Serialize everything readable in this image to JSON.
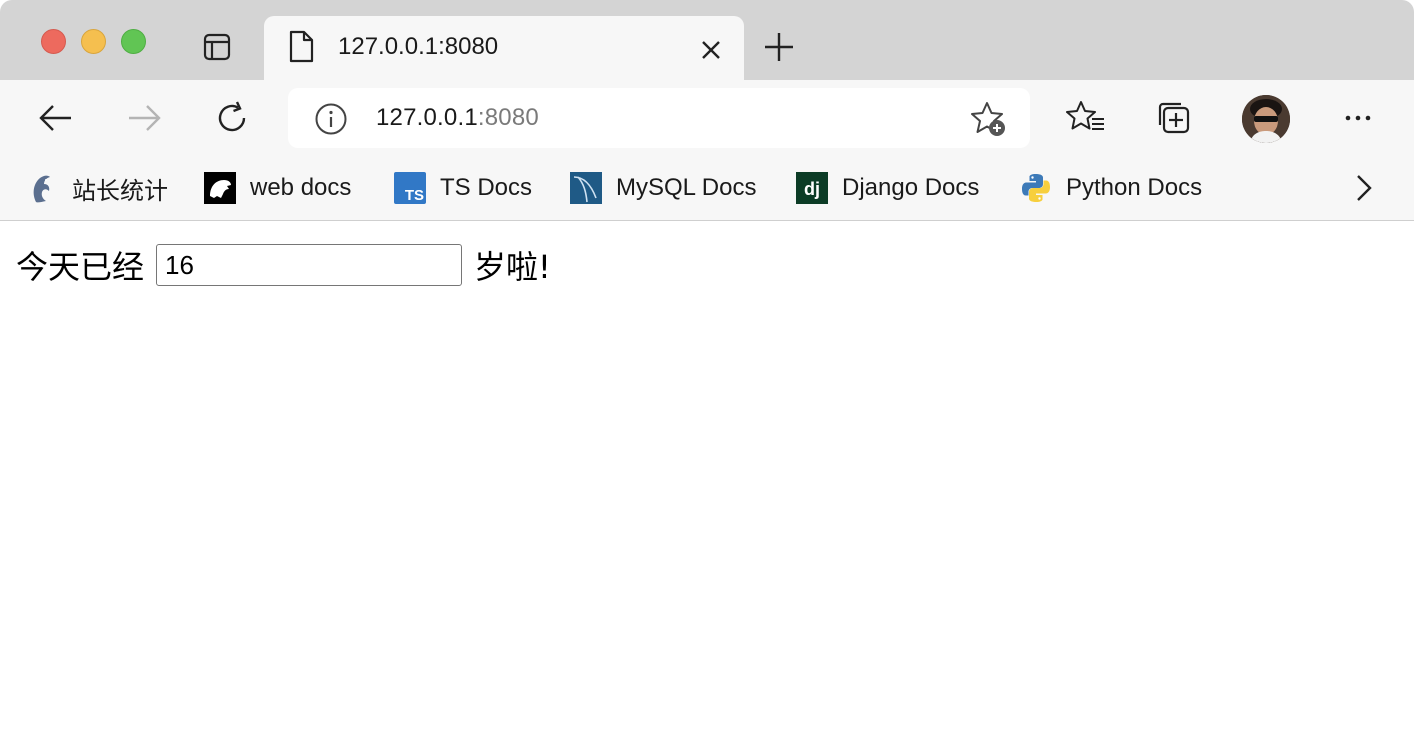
{
  "tab": {
    "title": "127.0.0.1:8080",
    "close_icon": "close-icon",
    "page_icon": "document-icon"
  },
  "address": {
    "host": "127.0.0.1",
    "port": ":8080"
  },
  "bookmarks": [
    {
      "label": "站长统计",
      "icon": "dolphin-icon"
    },
    {
      "label": "web docs",
      "icon": "mdn-icon"
    },
    {
      "label": "TS Docs",
      "icon": "ts-icon"
    },
    {
      "label": "MySQL Docs",
      "icon": "mysql-icon"
    },
    {
      "label": "Django Docs",
      "icon": "django-icon"
    },
    {
      "label": "Python Docs",
      "icon": "python-icon"
    }
  ],
  "content": {
    "prefix": "今天已经",
    "age_value": "16",
    "suffix": "岁啦!"
  },
  "colors": {
    "tabstrip": "#d4d4d4",
    "toolbar": "#f7f7f7",
    "traffic_close": "#ed6a5e",
    "traffic_min": "#f5bf4f",
    "traffic_max": "#61c554",
    "ts_brand": "#3178c6",
    "django_brand": "#0c3c26"
  }
}
